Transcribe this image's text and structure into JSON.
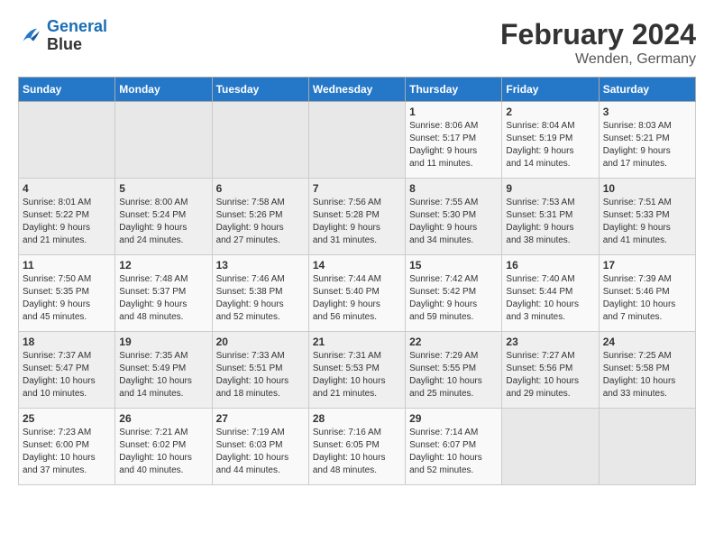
{
  "header": {
    "logo_line1": "General",
    "logo_line2": "Blue",
    "month": "February 2024",
    "location": "Wenden, Germany"
  },
  "days_of_week": [
    "Sunday",
    "Monday",
    "Tuesday",
    "Wednesday",
    "Thursday",
    "Friday",
    "Saturday"
  ],
  "weeks": [
    [
      {
        "day": "",
        "info": ""
      },
      {
        "day": "",
        "info": ""
      },
      {
        "day": "",
        "info": ""
      },
      {
        "day": "",
        "info": ""
      },
      {
        "day": "1",
        "info": "Sunrise: 8:06 AM\nSunset: 5:17 PM\nDaylight: 9 hours\nand 11 minutes."
      },
      {
        "day": "2",
        "info": "Sunrise: 8:04 AM\nSunset: 5:19 PM\nDaylight: 9 hours\nand 14 minutes."
      },
      {
        "day": "3",
        "info": "Sunrise: 8:03 AM\nSunset: 5:21 PM\nDaylight: 9 hours\nand 17 minutes."
      }
    ],
    [
      {
        "day": "4",
        "info": "Sunrise: 8:01 AM\nSunset: 5:22 PM\nDaylight: 9 hours\nand 21 minutes."
      },
      {
        "day": "5",
        "info": "Sunrise: 8:00 AM\nSunset: 5:24 PM\nDaylight: 9 hours\nand 24 minutes."
      },
      {
        "day": "6",
        "info": "Sunrise: 7:58 AM\nSunset: 5:26 PM\nDaylight: 9 hours\nand 27 minutes."
      },
      {
        "day": "7",
        "info": "Sunrise: 7:56 AM\nSunset: 5:28 PM\nDaylight: 9 hours\nand 31 minutes."
      },
      {
        "day": "8",
        "info": "Sunrise: 7:55 AM\nSunset: 5:30 PM\nDaylight: 9 hours\nand 34 minutes."
      },
      {
        "day": "9",
        "info": "Sunrise: 7:53 AM\nSunset: 5:31 PM\nDaylight: 9 hours\nand 38 minutes."
      },
      {
        "day": "10",
        "info": "Sunrise: 7:51 AM\nSunset: 5:33 PM\nDaylight: 9 hours\nand 41 minutes."
      }
    ],
    [
      {
        "day": "11",
        "info": "Sunrise: 7:50 AM\nSunset: 5:35 PM\nDaylight: 9 hours\nand 45 minutes."
      },
      {
        "day": "12",
        "info": "Sunrise: 7:48 AM\nSunset: 5:37 PM\nDaylight: 9 hours\nand 48 minutes."
      },
      {
        "day": "13",
        "info": "Sunrise: 7:46 AM\nSunset: 5:38 PM\nDaylight: 9 hours\nand 52 minutes."
      },
      {
        "day": "14",
        "info": "Sunrise: 7:44 AM\nSunset: 5:40 PM\nDaylight: 9 hours\nand 56 minutes."
      },
      {
        "day": "15",
        "info": "Sunrise: 7:42 AM\nSunset: 5:42 PM\nDaylight: 9 hours\nand 59 minutes."
      },
      {
        "day": "16",
        "info": "Sunrise: 7:40 AM\nSunset: 5:44 PM\nDaylight: 10 hours\nand 3 minutes."
      },
      {
        "day": "17",
        "info": "Sunrise: 7:39 AM\nSunset: 5:46 PM\nDaylight: 10 hours\nand 7 minutes."
      }
    ],
    [
      {
        "day": "18",
        "info": "Sunrise: 7:37 AM\nSunset: 5:47 PM\nDaylight: 10 hours\nand 10 minutes."
      },
      {
        "day": "19",
        "info": "Sunrise: 7:35 AM\nSunset: 5:49 PM\nDaylight: 10 hours\nand 14 minutes."
      },
      {
        "day": "20",
        "info": "Sunrise: 7:33 AM\nSunset: 5:51 PM\nDaylight: 10 hours\nand 18 minutes."
      },
      {
        "day": "21",
        "info": "Sunrise: 7:31 AM\nSunset: 5:53 PM\nDaylight: 10 hours\nand 21 minutes."
      },
      {
        "day": "22",
        "info": "Sunrise: 7:29 AM\nSunset: 5:55 PM\nDaylight: 10 hours\nand 25 minutes."
      },
      {
        "day": "23",
        "info": "Sunrise: 7:27 AM\nSunset: 5:56 PM\nDaylight: 10 hours\nand 29 minutes."
      },
      {
        "day": "24",
        "info": "Sunrise: 7:25 AM\nSunset: 5:58 PM\nDaylight: 10 hours\nand 33 minutes."
      }
    ],
    [
      {
        "day": "25",
        "info": "Sunrise: 7:23 AM\nSunset: 6:00 PM\nDaylight: 10 hours\nand 37 minutes."
      },
      {
        "day": "26",
        "info": "Sunrise: 7:21 AM\nSunset: 6:02 PM\nDaylight: 10 hours\nand 40 minutes."
      },
      {
        "day": "27",
        "info": "Sunrise: 7:19 AM\nSunset: 6:03 PM\nDaylight: 10 hours\nand 44 minutes."
      },
      {
        "day": "28",
        "info": "Sunrise: 7:16 AM\nSunset: 6:05 PM\nDaylight: 10 hours\nand 48 minutes."
      },
      {
        "day": "29",
        "info": "Sunrise: 7:14 AM\nSunset: 6:07 PM\nDaylight: 10 hours\nand 52 minutes."
      },
      {
        "day": "",
        "info": ""
      },
      {
        "day": "",
        "info": ""
      }
    ]
  ]
}
